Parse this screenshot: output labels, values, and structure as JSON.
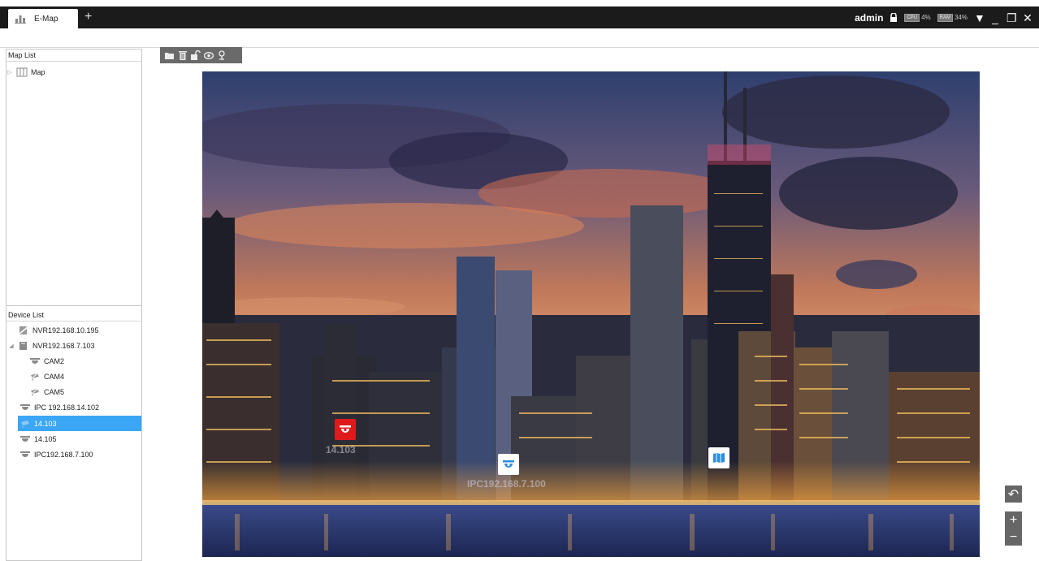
{
  "window": {
    "tab_label": "E-Map",
    "new_tab": "+",
    "user": "admin",
    "cpu_badge": "CPU",
    "cpu_value": "4%",
    "ram_badge": "RAM",
    "ram_value": "34%",
    "controls": [
      "▼",
      "_",
      "❐",
      "✕"
    ]
  },
  "map_list": {
    "header": "Map List",
    "items": [
      {
        "label": "Map",
        "icon": "map-icon"
      }
    ]
  },
  "device_list": {
    "header": "Device List",
    "items": [
      {
        "label": "NVR192.168.10.195",
        "icon": "nvr-offline-icon",
        "level": 0
      },
      {
        "label": "NVR192.168.7.103",
        "icon": "nvr-icon",
        "level": 0
      },
      {
        "label": "CAM2",
        "icon": "dome-camera-icon",
        "level": 1
      },
      {
        "label": "CAM4",
        "icon": "camera-offline-icon",
        "level": 1
      },
      {
        "label": "CAM5",
        "icon": "camera-offline-icon",
        "level": 1
      },
      {
        "label": "IPC 192.168.14.102",
        "icon": "dome-camera-icon",
        "level": 0
      },
      {
        "label": "14.103",
        "icon": "camera-offline-icon",
        "level": 0,
        "selected": true
      },
      {
        "label": "14.105",
        "icon": "dome-camera-icon",
        "level": 0
      },
      {
        "label": "IPC192.168.7.100",
        "icon": "dome-camera-icon",
        "level": 0
      }
    ]
  },
  "toolbar": [
    "folder-icon",
    "delete-icon",
    "unlock-icon",
    "eye-icon",
    "locate-icon"
  ],
  "map": {
    "markers": [
      {
        "label": "14.103",
        "icon": "dome-camera-icon",
        "color": "#e0191b"
      },
      {
        "label": "IPC192.168.7.100",
        "icon": "dome-camera-icon",
        "color": "#ffffff"
      },
      {
        "label": "",
        "icon": "map-link-icon",
        "color": "#ffffff"
      }
    ]
  },
  "map_controls": {
    "back": "↶",
    "zoom_in": "+",
    "zoom_out": "−"
  }
}
